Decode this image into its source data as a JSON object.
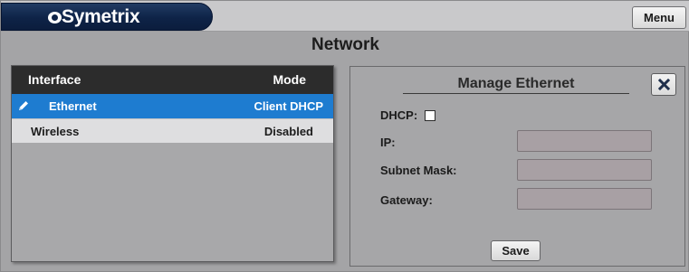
{
  "header": {
    "logo_text": "Symetrix",
    "menu_label": "Menu"
  },
  "page": {
    "title": "Network"
  },
  "interfaces": {
    "columns": {
      "interface": "Interface",
      "mode": "Mode"
    },
    "rows": [
      {
        "name": "Ethernet",
        "mode": "Client DHCP",
        "selected": true
      },
      {
        "name": "Wireless",
        "mode": "Disabled",
        "selected": false
      }
    ]
  },
  "manage": {
    "title": "Manage Ethernet",
    "dhcp_label": "DHCP:",
    "dhcp_checked": false,
    "ip_label": "IP:",
    "ip_value": "",
    "subnet_label": "Subnet Mask:",
    "subnet_value": "",
    "gateway_label": "Gateway:",
    "gateway_value": "",
    "save_label": "Save"
  },
  "colors": {
    "selected_row": "#1e7cd0",
    "header_bg": "#2c2c2c",
    "logo_bg": "#0e2347",
    "background": "#a4a4a6"
  },
  "icons": {
    "edit": "pencil-icon",
    "close": "close-icon",
    "logo": "symetrix-logo-icon"
  }
}
